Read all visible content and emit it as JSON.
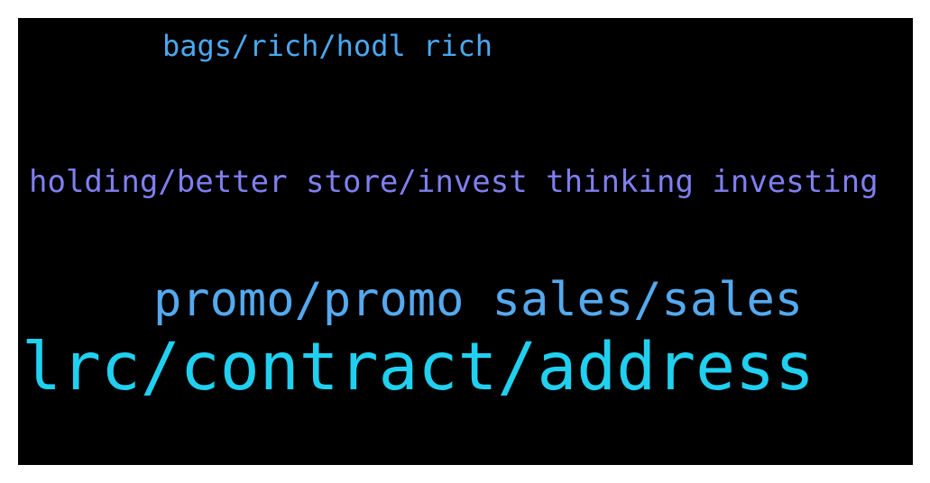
{
  "word_cloud": {
    "background_color": "#000000",
    "words": [
      {
        "text": "bags/rich/hodl rich",
        "color": "#4aa8f0"
      },
      {
        "text": "holding/better store/invest thinking investing",
        "color": "#7f7ff0"
      },
      {
        "text": "promo/promo sales/sales",
        "color": "#55a9ee"
      },
      {
        "text": "lrc/contract/address",
        "color": "#20d0f0"
      }
    ]
  }
}
